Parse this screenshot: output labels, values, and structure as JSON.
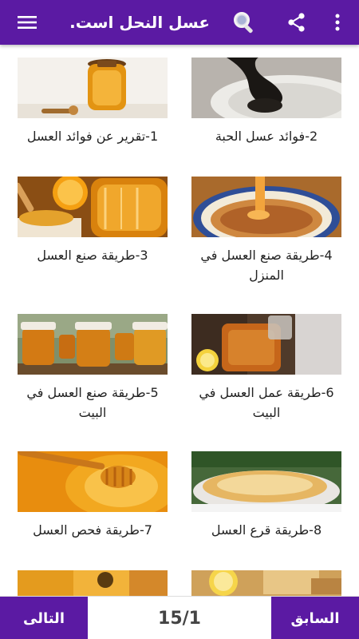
{
  "appbar": {
    "title": "عسل النحل است...",
    "menu_icon": "hamburger-menu-icon",
    "search_icon": "search-icon",
    "share_icon": "share-icon",
    "more_icon": "more-vertical-icon"
  },
  "colors": {
    "primary": "#5b1aa3",
    "text": "#222222"
  },
  "articles": [
    {
      "title": "1-تقرير عن فوائد العسل",
      "image": "honey-jar-dipper-photo"
    },
    {
      "title": "2-فوائد عسل الحبة",
      "image": "black-seed-honey-bowl-photo"
    },
    {
      "title": "3-طريقة صنع العسل",
      "image": "honey-oranges-photo"
    },
    {
      "title": "4-طريقة صنع العسل في المنزل",
      "image": "homemade-honey-bowl-photo"
    },
    {
      "title": "5-طريقة صنع العسل في البيت",
      "image": "honey-jars-photo"
    },
    {
      "title": "6-طريقة عمل العسل في البيت",
      "image": "honey-jar-lemon-photo"
    },
    {
      "title": "7-طريقة فحص العسل",
      "image": "honey-dipper-closeup-photo"
    },
    {
      "title": "8-طريقة قرع العسل",
      "image": "honey-pie-photo"
    },
    {
      "title": "",
      "image": "honeycomb-bee-photo"
    },
    {
      "title": "",
      "image": "lemon-honey-tea-photo"
    }
  ],
  "pagination": {
    "next_label": "التالى",
    "prev_label": "السابق",
    "counter": "15/1"
  }
}
